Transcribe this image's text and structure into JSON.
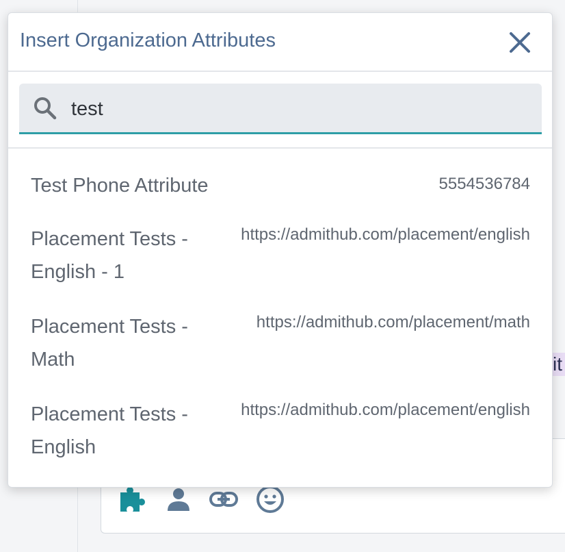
{
  "modal": {
    "title": "Insert Organization Attributes",
    "close_icon": "close-icon"
  },
  "search": {
    "value": "test",
    "icon": "search-icon"
  },
  "results": [
    {
      "name": "Test Phone Attribute",
      "value": "5554536784"
    },
    {
      "name": "Placement Tests - English - 1",
      "value": "https://admithub.com/placement/english"
    },
    {
      "name": "Placement Tests - Math",
      "value": "https://admithub.com/placement/math"
    },
    {
      "name": "Placement Tests - English",
      "value": "https://admithub.com/placement/english"
    }
  ],
  "background": {
    "highlight_text": "it",
    "toolbar_icons": [
      "puzzle-icon",
      "person-icon",
      "link-icon",
      "smiley-icon"
    ]
  },
  "colors": {
    "accent": "#2e9ea6",
    "title": "#4d6a90",
    "toolbar_icon": "#5f7a96",
    "puzzle_icon": "#1a8f9a"
  }
}
